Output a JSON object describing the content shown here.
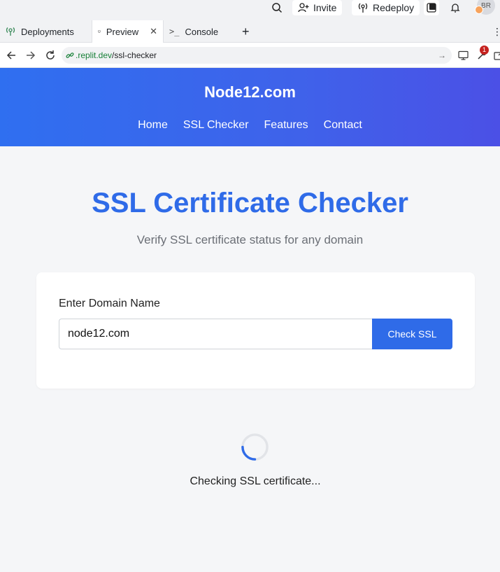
{
  "topbar": {
    "invite_label": "Invite",
    "redeploy_label": "Redeploy",
    "avatar_initials": "BR"
  },
  "tabs": [
    {
      "label": "Deployments",
      "icon": "deployments-icon",
      "active": false
    },
    {
      "label": "Preview",
      "icon": "monitor-icon",
      "active": true
    },
    {
      "label": "Console",
      "icon": "terminal-icon",
      "active": false
    }
  ],
  "browser": {
    "url_host": ".replit.dev",
    "url_path": "/ssl-checker",
    "notification_count": "1"
  },
  "site": {
    "title": "Node12.com",
    "nav": [
      "Home",
      "SSL Checker",
      "Features",
      "Contact"
    ]
  },
  "main": {
    "heading": "SSL Certificate Checker",
    "subheading": "Verify SSL certificate status for any domain",
    "form": {
      "label": "Enter Domain Name",
      "input_value": "node12.com",
      "button_label": "Check SSL"
    },
    "loading_text": "Checking SSL certificate..."
  },
  "colors": {
    "accent": "#2f6be8",
    "header_gradient_start": "#2f6ff0",
    "header_gradient_end": "#4b50e6"
  }
}
